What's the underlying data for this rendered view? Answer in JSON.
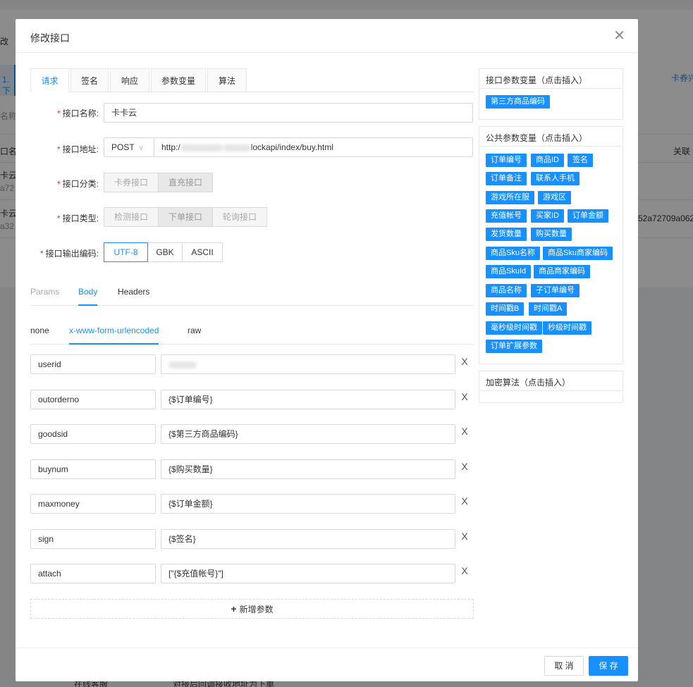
{
  "background": {
    "left_tab": "1.下",
    "right_link": "卡券兴",
    "search_hint": "名称",
    "col_name": "口名",
    "col_right": "关联",
    "row1_name": "卡云",
    "row1_sub": "a72",
    "row2_name": "卡云",
    "row2_sub": "a32",
    "row2_right": "52a72709a062",
    "left_edge": "改",
    "bottom_left": "在线客服",
    "bottom_mid": "对接后回调接收地址为下单"
  },
  "modal": {
    "title": "修改接口",
    "close": "✕",
    "tabs": [
      "请求",
      "签名",
      "响应",
      "参数变量",
      "算法"
    ],
    "fields": {
      "name_label": "接口名称:",
      "name_value": "卡卡云",
      "url_label": "接口地址:",
      "method": "POST",
      "url_prefix": "http:/",
      "url_suffix": "lockapi/index/buy.html",
      "category_label": "接口分类:",
      "category_options": [
        "卡券接口",
        "直充接口"
      ],
      "type_label": "接口类型:",
      "type_options": [
        "检测接口",
        "下单接口",
        "轮询接口"
      ],
      "encoding_label": "接口输出编码:",
      "encoding_options": [
        "UTF-8",
        "GBK",
        "ASCII"
      ]
    },
    "req_tabs": [
      "Params",
      "Body",
      "Headers"
    ],
    "body_tabs": [
      "none",
      "x-www-form-urlencoded",
      "raw"
    ],
    "params": [
      {
        "key": "userid",
        "value": ""
      },
      {
        "key": "outorderno",
        "value": "{$订单编号}"
      },
      {
        "key": "goodsid",
        "value": "{$第三方商品编码}"
      },
      {
        "key": "buynum",
        "value": "{$购买数量}"
      },
      {
        "key": "maxmoney",
        "value": "{$订单金额}"
      },
      {
        "key": "sign",
        "value": "{$签名}"
      },
      {
        "key": "attach",
        "value": "[\"{$充值帐号}\"]"
      }
    ],
    "delete_glyph": "X",
    "add_param": "新增参数",
    "add_plus": "+",
    "panels": {
      "iface_title": "接口参数变量（点击插入）",
      "iface_chips": [
        "第三方商品编码"
      ],
      "public_title": "公共参数变量（点击插入）",
      "public_chips": [
        "订单编号",
        "商品ID",
        "签名",
        "订单备注",
        "联系人手机",
        "游戏所在服",
        "游戏区",
        "充值帐号",
        "买家ID",
        "订单金额",
        "发货数量",
        "购买数量",
        "商品Sku名称",
        "商品Sku商家编码",
        "商品SkuId",
        "商品商家编码",
        "商品名称",
        "子订单编号",
        "时间戳B",
        "时间戳A",
        "毫秒级时间戳",
        "秒级时间戳",
        "订单扩展参数"
      ],
      "algo_title": "加密算法（点击插入）"
    },
    "cancel": "取 消",
    "save": "保 存"
  },
  "colors": {
    "accent": "#1890ff",
    "required": "#f5222d"
  }
}
